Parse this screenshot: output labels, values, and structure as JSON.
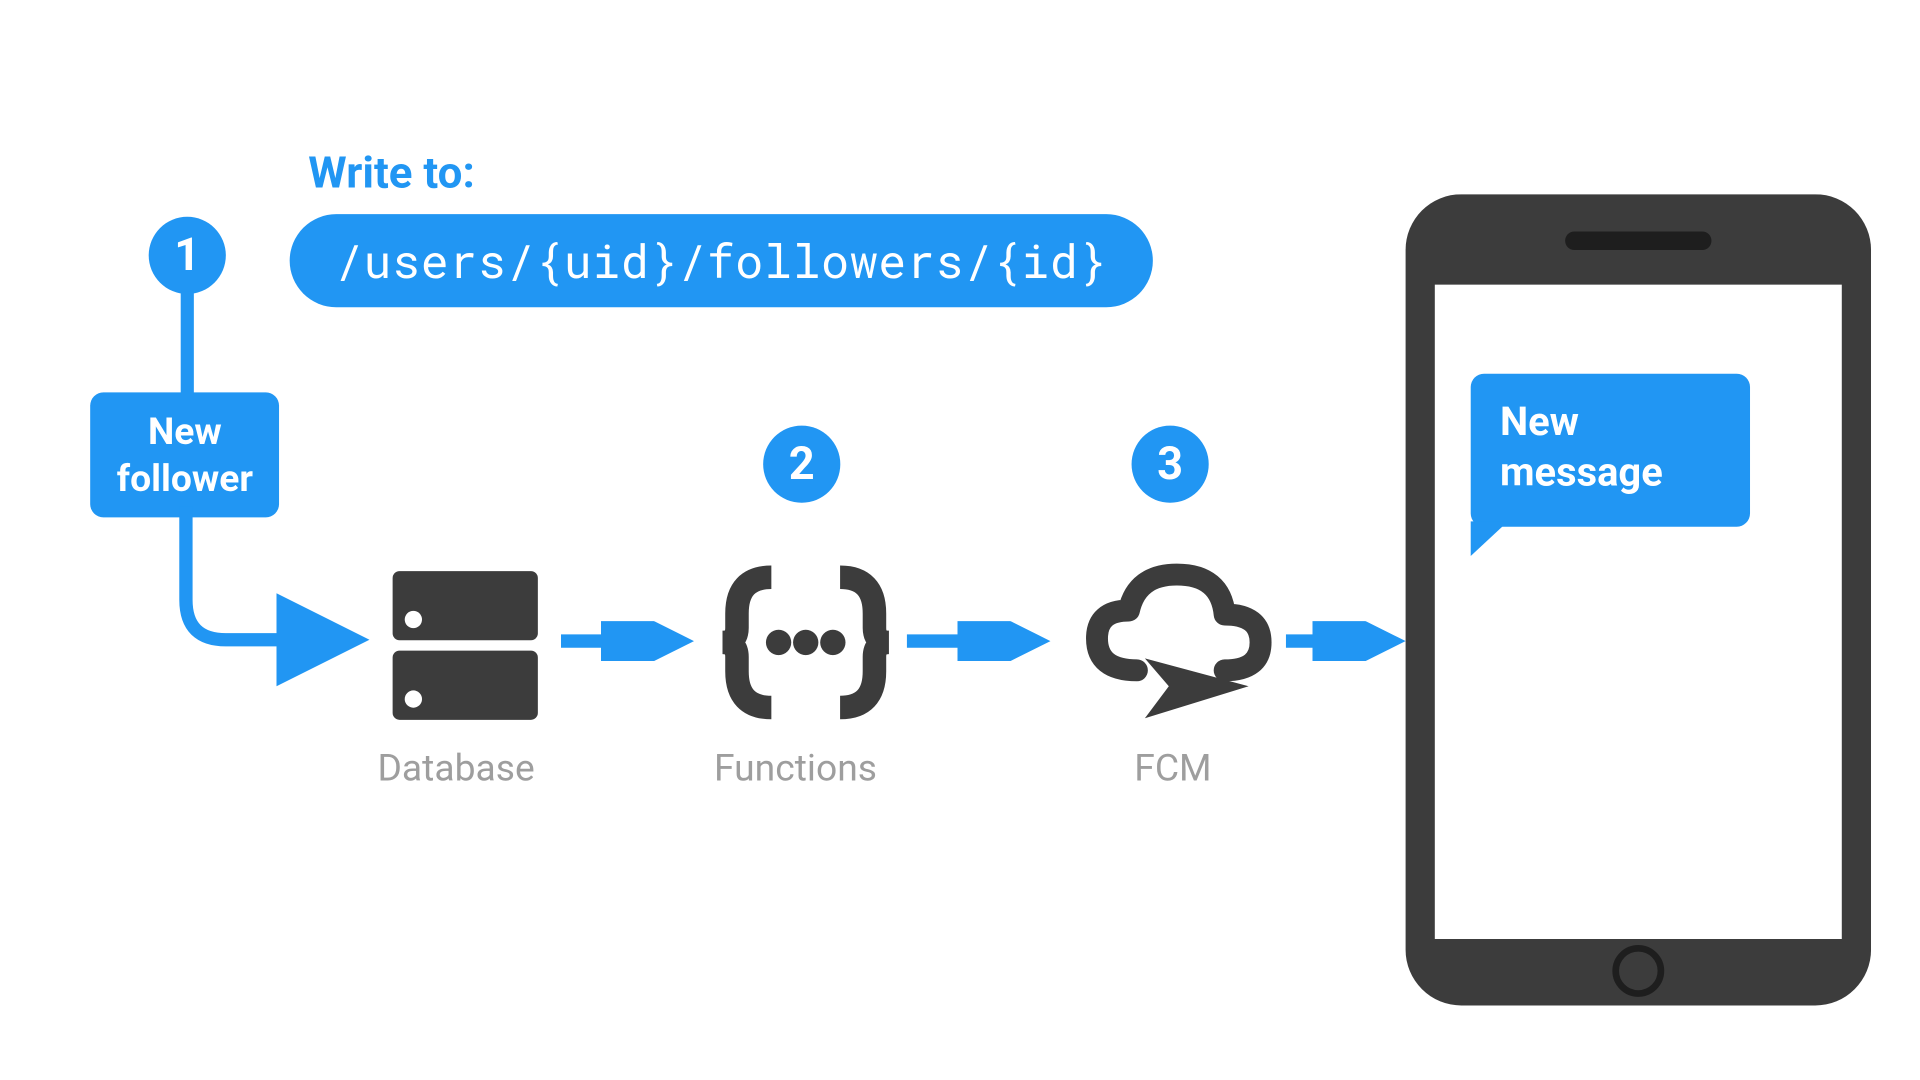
{
  "colors": {
    "accent": "#2196f3",
    "icon": "#3c3c3c",
    "label": "#9e9e9e"
  },
  "header": {
    "write_to": "Write to:",
    "path": "/users/{uid}/followers/{id}"
  },
  "trigger": {
    "line1": "New",
    "line2": "follower"
  },
  "steps": {
    "one": {
      "badge": "1"
    },
    "two": {
      "badge": "2",
      "label": "Functions"
    },
    "three": {
      "badge": "3",
      "label": "FCM"
    },
    "db": {
      "label": "Database"
    }
  },
  "phone": {
    "message_line1": "New",
    "message_line2": "message"
  }
}
